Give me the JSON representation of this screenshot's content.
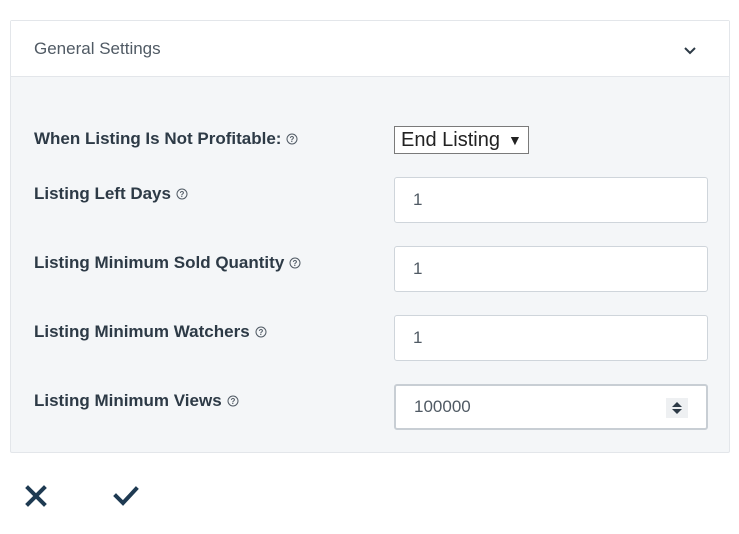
{
  "panel": {
    "title": "General Settings"
  },
  "fields": {
    "not_profitable": {
      "label": "When Listing Is Not Profitable:",
      "value": "End Listing"
    },
    "left_days": {
      "label": "Listing Left Days",
      "value": "1"
    },
    "min_sold_quantity": {
      "label": "Listing Minimum Sold Quantity",
      "value": "1"
    },
    "min_watchers": {
      "label": "Listing Minimum Watchers",
      "value": "1"
    },
    "min_views": {
      "label": "Listing Minimum Views",
      "value": "100000"
    }
  },
  "colors": {
    "label_text": "#2d3a46",
    "action_icon": "#1e3a52",
    "panel_background": "#f4f6f8"
  },
  "icons": {
    "collapse": "chevron-down-icon",
    "help": "help-circle-icon",
    "cancel": "close-icon",
    "confirm": "check-icon"
  }
}
